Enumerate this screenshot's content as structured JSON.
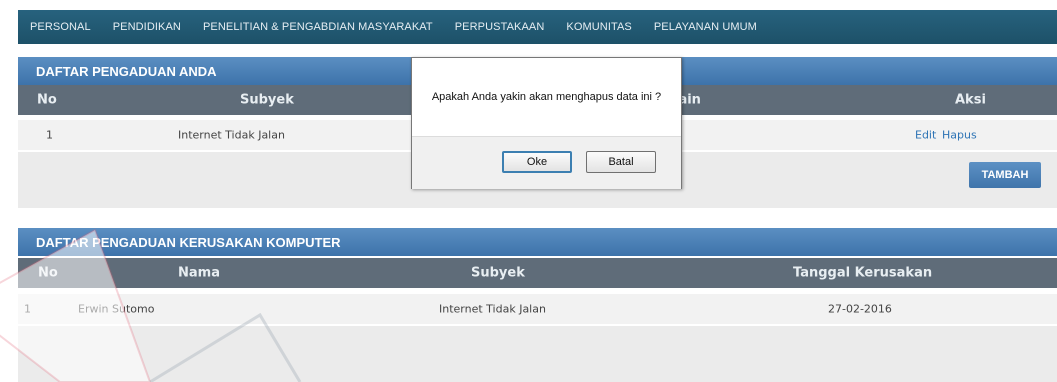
{
  "nav": [
    "PERSONAL",
    "PENDIDIKAN",
    "PENELITIAN & PENGABDIAN MASYARAKAT",
    "PERPUSTAKAAN",
    "KOMUNITAS",
    "PELAYANAN UMUM"
  ],
  "complaints": {
    "title": "DAFTAR PENGADUAN ANDA",
    "columns": [
      "No",
      "Subyek",
      "lain",
      "Aksi"
    ],
    "rows": [
      {
        "no": "1",
        "subject": "Internet Tidak Jalan",
        "edit": "Edit",
        "delete": "Hapus"
      }
    ],
    "add_label": "TAMBAH"
  },
  "damage": {
    "title": "DAFTAR PENGADUAN KERUSAKAN KOMPUTER",
    "columns": [
      "No",
      "Nama",
      "Subyek",
      "Tanggal Kerusakan"
    ],
    "rows": [
      {
        "no": "1",
        "name": "Erwin Sutomo",
        "subject": "Internet Tidak Jalan",
        "date": "27-02-2016"
      }
    ]
  },
  "dialog": {
    "message": "Apakah Anda yakin akan menghapus data ini ?",
    "ok_label": "Oke",
    "cancel_label": "Batal"
  },
  "colors": {
    "nav_bg": "#1d5168",
    "panel_header": "#3d73aa",
    "table_head": "#5f6c79",
    "link": "#2e74b5"
  }
}
